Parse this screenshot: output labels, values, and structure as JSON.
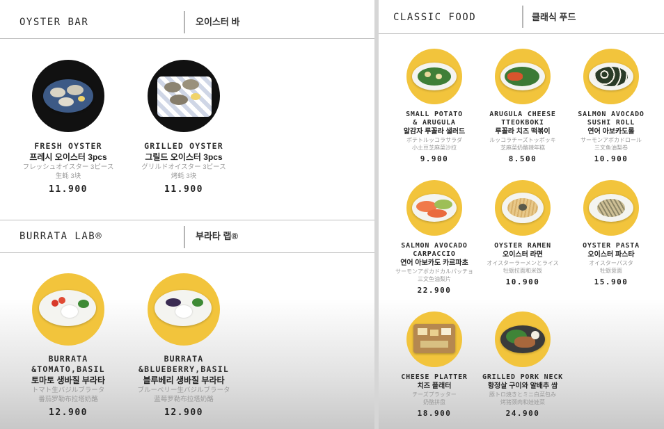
{
  "left": {
    "oyster_bar": {
      "title_en": "OYSTER BAR",
      "title_ko": "오이스터 바",
      "items": [
        {
          "en": [
            "FRESH OYSTER"
          ],
          "ko": "프레시 오이스터 3pcs",
          "jp": "フレッシュオイスター 3ピース",
          "cn": "生蚝 3块",
          "price": "11.900",
          "icon": "oyster-plate-icon"
        },
        {
          "en": [
            "GRILLED OYSTER"
          ],
          "ko": "그릴드 오이스터 3pcs",
          "jp": "グリルドオイスター 3ピース",
          "cn": "烤蚝 3块",
          "price": "11.900",
          "icon": "grilled-oyster-plate-icon"
        }
      ]
    },
    "burrata_lab": {
      "title_en": "BURRATA LAB®",
      "title_ko": "부라타 랩®",
      "items": [
        {
          "en": [
            "BURRATA",
            "&TOMATO,BASIL"
          ],
          "ko": "토마토 생바질 부라타",
          "jp": "トマト生バジルブラータ",
          "cn": "番茄罗勒布拉塔奶酪",
          "price": "12.900",
          "icon": "burrata-tomato-plate-icon"
        },
        {
          "en": [
            "BURRATA",
            "&BLUEBERRY,BASIL"
          ],
          "ko": "블루베리 생바질 부라타",
          "jp": "ブルーベリー生バジルブラータ",
          "cn": "蓝莓罗勒布拉塔奶酪",
          "price": "12.900",
          "icon": "burrata-blueberry-plate-icon"
        }
      ]
    }
  },
  "right": {
    "classic_food": {
      "title_en": "CLASSIC FOOD",
      "title_ko": "클래식 푸드",
      "items": [
        {
          "en": [
            "SMALL POTATO",
            "& ARUGULA"
          ],
          "ko": "알감자 루꼴라 샐러드",
          "jp": "ポテトルッコラサラダ",
          "cn": "小土豆芝麻菜沙拉",
          "price": "9.900",
          "icon": "potato-salad-plate-icon"
        },
        {
          "en": [
            "ARUGULA CHEESE",
            "TTEOKBOKI"
          ],
          "ko": "루꼴라 치즈 떡볶이",
          "jp": "ルッコラチーズトッポッキ",
          "cn": "芝麻菜奶酪辣年糕",
          "price": "8.500",
          "icon": "tteokboki-plate-icon"
        },
        {
          "en": [
            "SALMON AVOCADO",
            "SUSHI ROLL"
          ],
          "ko": "연어 아보카도롤",
          "jp": "サーモンアボカドロール",
          "cn": "三文鱼油梨卷",
          "price": "10.900",
          "icon": "sushi-roll-plate-icon"
        },
        {
          "en": [
            "SALMON AVOCADO",
            "CARPACCIO"
          ],
          "ko": "연어 아보카도 카르파초",
          "jp": "サーモンアボカドカルパッチョ",
          "cn": "三文鱼油梨片",
          "price": "22.900",
          "icon": "carpaccio-plate-icon"
        },
        {
          "en": [
            "OYSTER RAMEN"
          ],
          "ko": "오이스터 라면",
          "jp": "オイスターラーメンとライス",
          "cn": "牡蛎拉面和米饭",
          "price": "10.900",
          "icon": "ramen-bowl-icon"
        },
        {
          "en": [
            "OYSTER PASTA"
          ],
          "ko": "오이스터 파스타",
          "jp": "オイスターパスタ",
          "cn": "牡蛎意面",
          "price": "15.900",
          "icon": "pasta-plate-icon"
        },
        {
          "en": [
            "CHEESE PLATTER"
          ],
          "ko": "치즈 플래터",
          "jp": "チーズプラッター",
          "cn": "奶酪拼盘",
          "price": "18.900",
          "icon": "cheese-board-icon"
        },
        {
          "en": [
            "GRILLED PORK NECK"
          ],
          "ko": "항정살 구이와 알배추 쌈",
          "jp": "豚トロ焼きとミニ白菜包み",
          "cn": "烤猪颈肉和娃娃菜",
          "price": "24.900",
          "icon": "pork-neck-plate-icon"
        }
      ]
    }
  },
  "colors": {
    "accent": "#f2c43c",
    "dark_plate": "#111111",
    "divider": "#bdbdbd"
  }
}
